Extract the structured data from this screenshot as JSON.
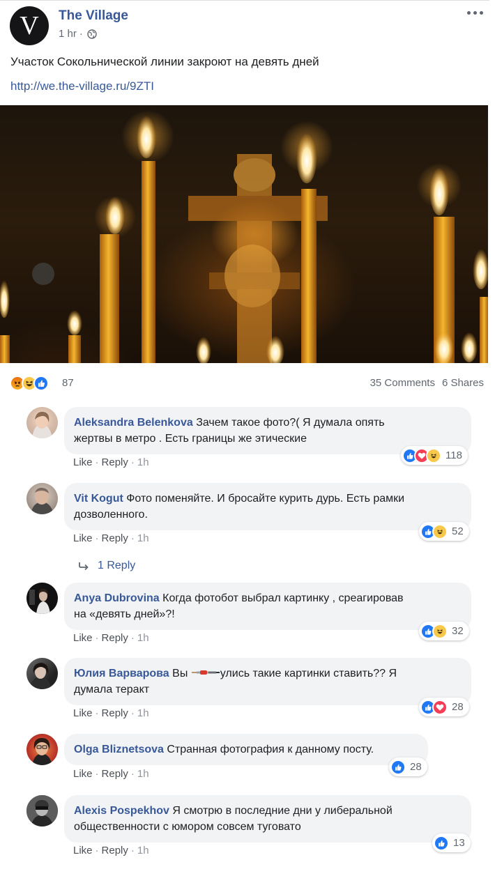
{
  "post": {
    "page_name": "The Village",
    "avatar_letter": "V",
    "time": "1 hr",
    "separator": "·",
    "text": "Участок Сокольнической линии закроют на девять дней",
    "link": "http://we.the-village.ru/9ZTI",
    "image_icon": "candles-crucifix-photo"
  },
  "reactions": {
    "icons": [
      "angry-icon",
      "haha-icon",
      "like-icon"
    ],
    "count": "87",
    "comments": "35 Comments",
    "shares": "6 Shares"
  },
  "comment_actions": {
    "like": "Like",
    "reply": "Reply",
    "sep": "·"
  },
  "comments": [
    {
      "author": "Aleksandra Belenkova",
      "text": "Зачем такое фото?( Я думала опять",
      "text2": "жертвы в метро . Есть границы же этические",
      "time": "1h",
      "reactions": [
        "like",
        "love",
        "haha"
      ],
      "reaction_count": "118"
    },
    {
      "author": "Vit Kogut",
      "text": "Фото поменяйте. И бросайте курить дурь. Есть рамки",
      "text2": "дозволенного.",
      "time": "1h",
      "reactions": [
        "like",
        "haha"
      ],
      "reaction_count": "52",
      "replies": "1 Reply"
    },
    {
      "author": "Anya Dubrovina",
      "text": "Когда фотобот выбрал картинку , среагировав",
      "text2": "на «девять дней»?!",
      "time": "1h",
      "reactions": [
        "like",
        "haha"
      ],
      "reaction_count": "32"
    },
    {
      "author": "Юлия Варварова",
      "text_a": "Вы",
      "text_b": "улись такие картинки ставить?? Я",
      "text2": "думала теракт",
      "time": "1h",
      "reactions": [
        "like",
        "love"
      ],
      "reaction_count": "28"
    },
    {
      "author": "Olga Bliznetsova",
      "text": "Странная фотография к данному посту.",
      "time": "1h",
      "reactions": [
        "like"
      ],
      "reaction_count": "28"
    },
    {
      "author": "Alexis Pospekhov",
      "text": "Я смотрю в последние дни у либеральной",
      "text2": "общественности с юмором совсем туговато",
      "time": "1h",
      "reactions": [
        "like"
      ],
      "reaction_count": "13"
    }
  ]
}
